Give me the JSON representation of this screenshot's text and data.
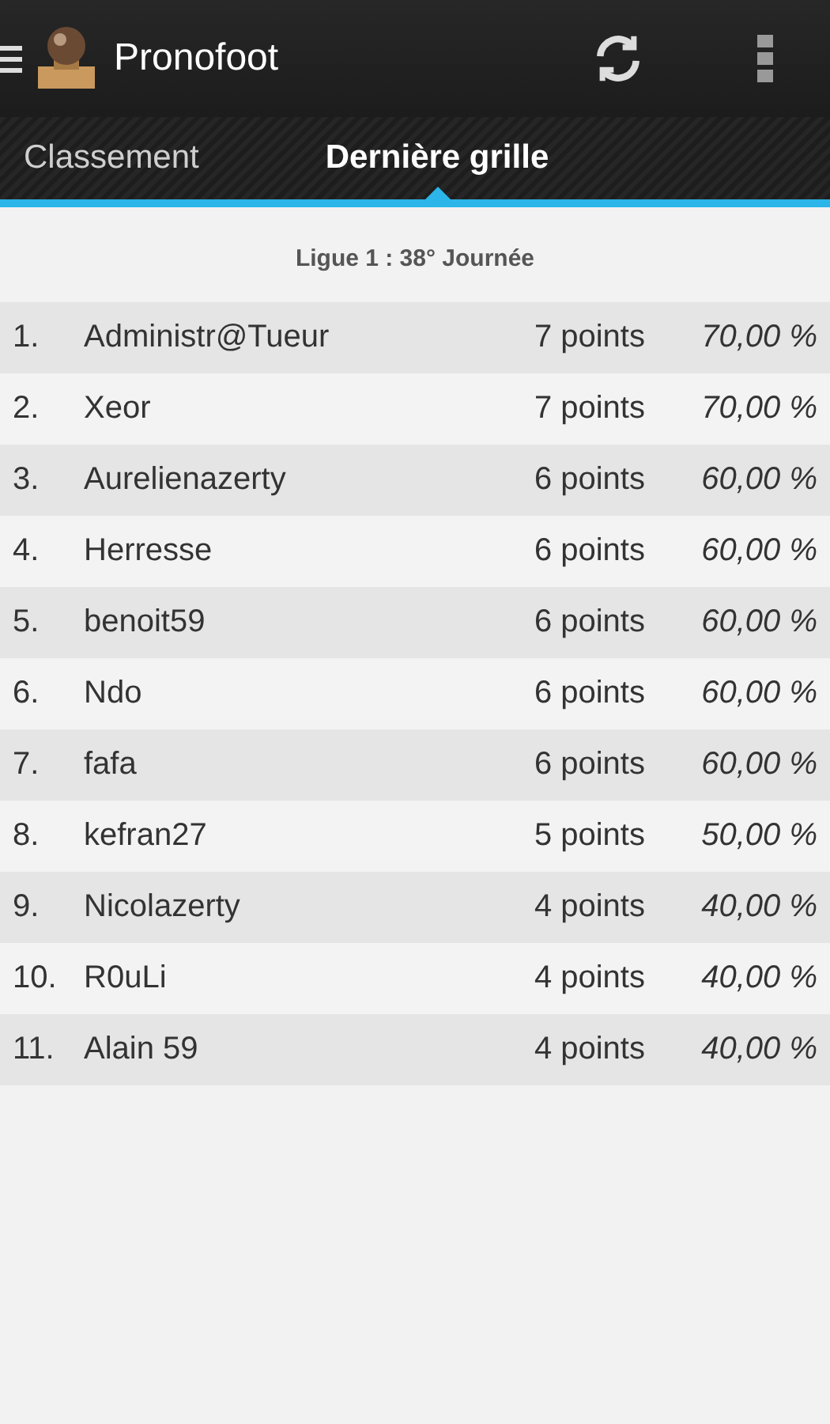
{
  "app_bar": {
    "title": "Pronofoot"
  },
  "tabs": [
    {
      "label": "Classement",
      "selected": false
    },
    {
      "label": "Dernière grille",
      "selected": true
    }
  ],
  "subtitle": "Ligue 1 : 38° Journée",
  "rows": [
    {
      "rank": "1.",
      "name": "Administr@Tueur",
      "points": "7 points",
      "percent": "70,00 %"
    },
    {
      "rank": "2.",
      "name": "Xeor",
      "points": "7 points",
      "percent": "70,00 %"
    },
    {
      "rank": "3.",
      "name": "Aurelienazerty",
      "points": "6 points",
      "percent": "60,00 %"
    },
    {
      "rank": "4.",
      "name": "Herresse",
      "points": "6 points",
      "percent": "60,00 %"
    },
    {
      "rank": "5.",
      "name": "benoit59",
      "points": "6 points",
      "percent": "60,00 %"
    },
    {
      "rank": "6.",
      "name": "Ndo",
      "points": "6 points",
      "percent": "60,00 %"
    },
    {
      "rank": "7.",
      "name": "fafa",
      "points": "6 points",
      "percent": "60,00 %"
    },
    {
      "rank": "8.",
      "name": "kefran27",
      "points": "5 points",
      "percent": "50,00 %"
    },
    {
      "rank": "9.",
      "name": "Nicolazerty",
      "points": "4 points",
      "percent": "40,00 %"
    },
    {
      "rank": "10.",
      "name": "R0uLi",
      "points": "4 points",
      "percent": "40,00 %"
    },
    {
      "rank": "11.",
      "name": "Alain 59",
      "points": "4 points",
      "percent": "40,00 %"
    }
  ]
}
